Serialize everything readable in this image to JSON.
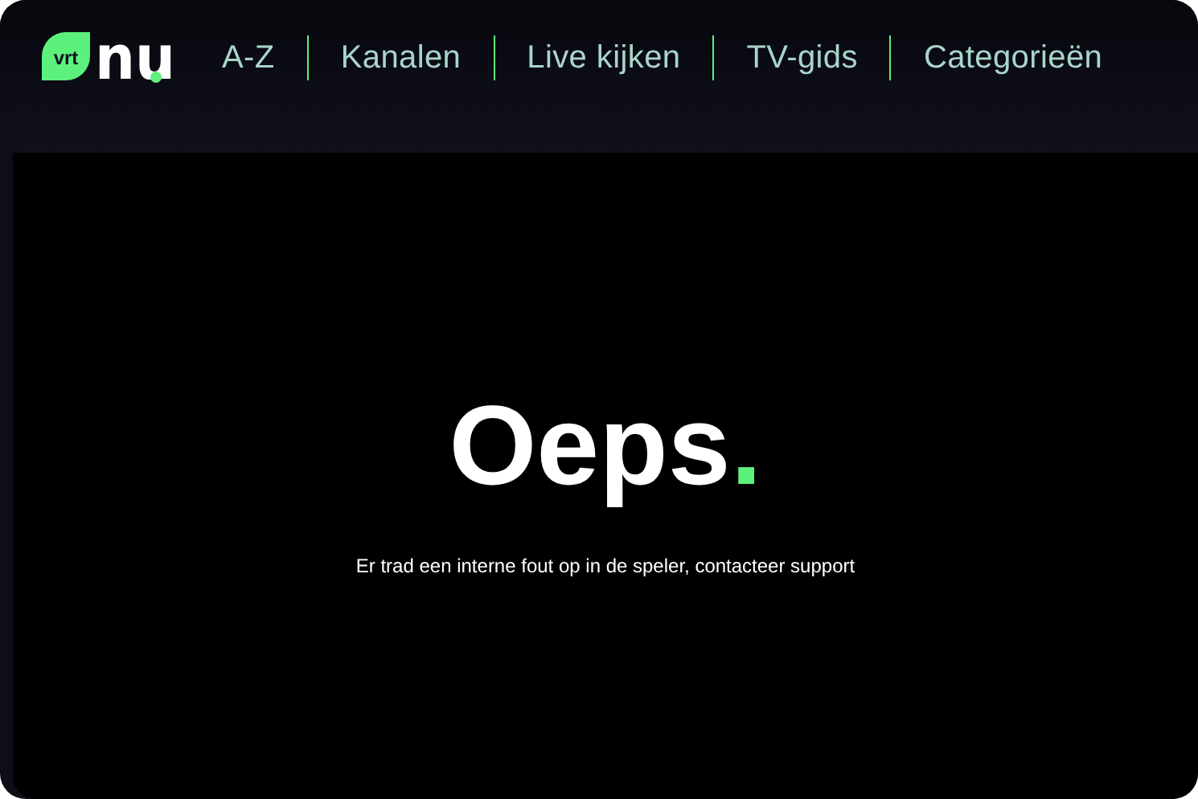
{
  "logo": {
    "badge": "vrt",
    "wordmark": "nu"
  },
  "nav": [
    {
      "label": "A-Z"
    },
    {
      "label": "Kanalen"
    },
    {
      "label": "Live kijken"
    },
    {
      "label": "TV-gids"
    },
    {
      "label": "Categorieën"
    }
  ],
  "error": {
    "title": "Oeps",
    "title_mark": ".",
    "message": "Er trad een interne fout op in de speler, contacteer support"
  }
}
